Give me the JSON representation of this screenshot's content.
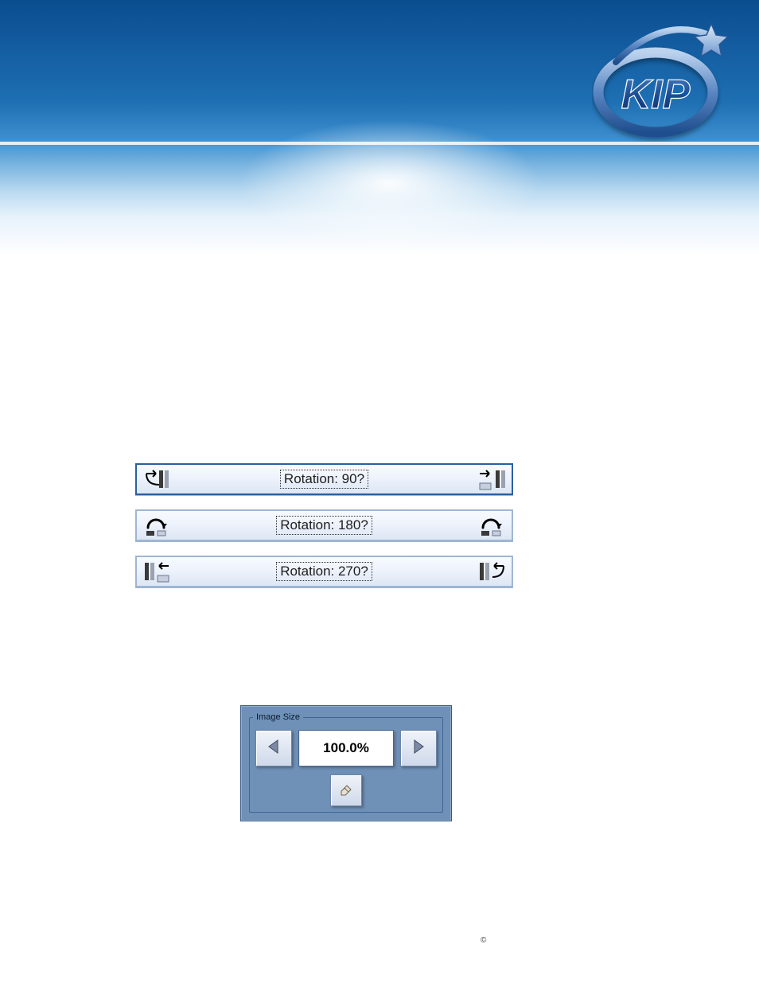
{
  "brand": {
    "name": "KIP"
  },
  "rotation_bars": [
    {
      "label": "Rotation: 90?",
      "icon": "rotate-90-icon",
      "style": "dark"
    },
    {
      "label": "Rotation: 180?",
      "icon": "rotate-180-icon",
      "style": "light"
    },
    {
      "label": "Rotation: 270?",
      "icon": "rotate-270-icon",
      "style": "light"
    }
  ],
  "image_size": {
    "legend": "Image Size",
    "value": "100.0%",
    "prev_icon": "triangle-left-icon",
    "next_icon": "triangle-right-icon",
    "reset_icon": "eraser-icon"
  },
  "footer": {
    "copyright_symbol": "©"
  }
}
